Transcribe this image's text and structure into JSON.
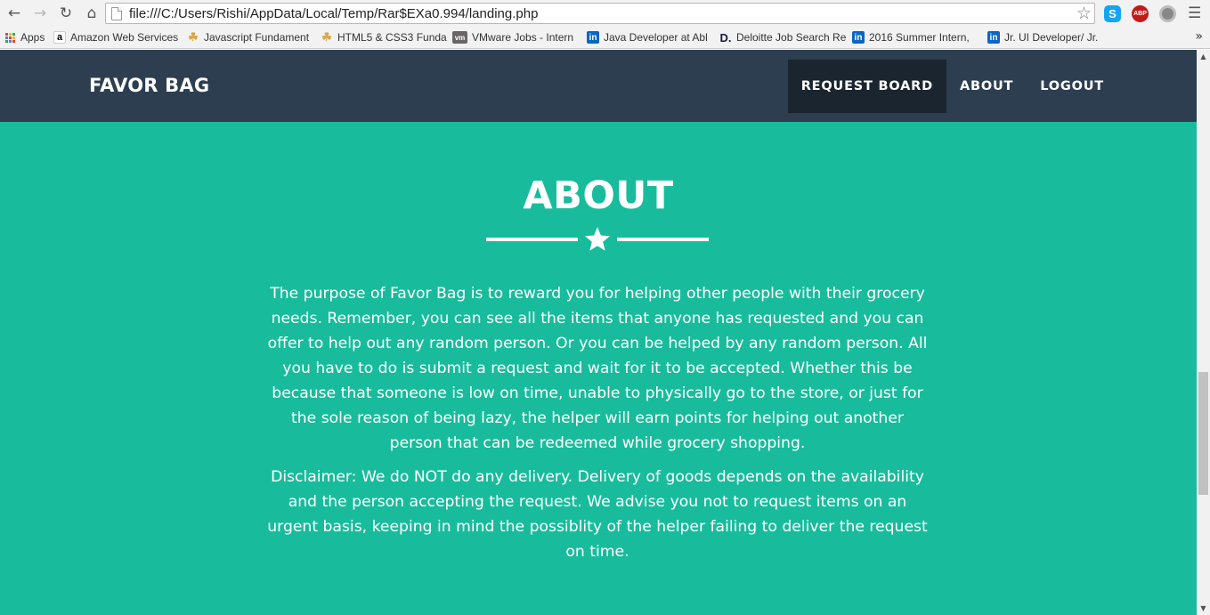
{
  "browser": {
    "url": "file:///C:/Users/Rishi/AppData/Local/Temp/Rar$EXa0.994/landing.php",
    "extensions": [
      "skype-icon",
      "adblock-plus-icon",
      "ghostery-icon"
    ],
    "abp_label": "ABP",
    "bookmarks": [
      {
        "icon": "apps-grid-icon",
        "label": "Apps"
      },
      {
        "icon": "amazon-icon",
        "label": "Amazon Web Services"
      },
      {
        "icon": "thumbs-icon",
        "label": "Javascript Fundament"
      },
      {
        "icon": "thumbs-icon",
        "label": "HTML5 & CSS3 Funda"
      },
      {
        "icon": "vmware-icon",
        "label": "VMware Jobs - Intern"
      },
      {
        "icon": "linkedin-icon",
        "label": "Java Developer at Abl"
      },
      {
        "icon": "deloitte-icon",
        "label": "Deloitte Job Search Re"
      },
      {
        "icon": "linkedin-icon",
        "label": "2016 Summer Intern, "
      },
      {
        "icon": "linkedin-icon",
        "label": "Jr. UI Developer/ Jr. Fr"
      }
    ]
  },
  "navbar": {
    "brand": "FAVOR BAG",
    "links": [
      "REQUEST BOARD",
      "ABOUT",
      "LOGOUT"
    ],
    "active_link": "REQUEST BOARD"
  },
  "about": {
    "title": "ABOUT",
    "paragraph1": "The purpose of Favor Bag is to reward you for helping other people with their grocery needs. Remember, you can see all the items that anyone has requested and you can offer to help out any random person. Or you can be helped by any random person. All you have to do is submit a request and wait for it to be accepted. Whether this be because that someone is low on time, unable to physically go to the store, or just for the sole reason of being lazy, the helper will earn points for helping out another person that can be redeemed while grocery shopping.",
    "paragraph2": "Disclaimer: We do NOT do any delivery. Delivery of goods depends on the availability and the person accepting the request. We advise you not to request items on an urgent basis, keeping in mind the possiblity of the helper failing to deliver the request on time."
  },
  "colors": {
    "navbar": "#2c3e50",
    "navbar_active": "#1a252f",
    "section_bg": "#18bc9c",
    "text": "#ffffff"
  }
}
